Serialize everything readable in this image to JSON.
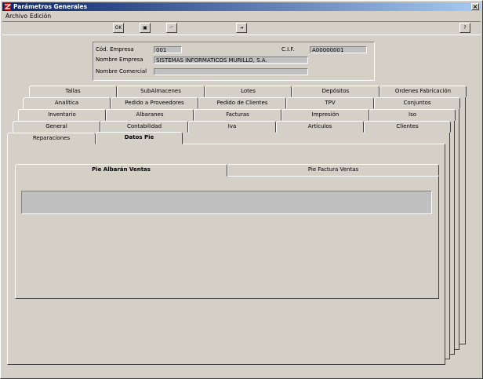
{
  "window": {
    "title": "Parámetros Generales",
    "close_label": "×"
  },
  "menu": [
    {
      "label": "Archivo"
    },
    {
      "label": "Edición"
    }
  ],
  "toolbar": {
    "buttons": [
      {
        "name": "ok",
        "glyph": "OK"
      },
      {
        "name": "save",
        "glyph": "▣"
      },
      {
        "name": "undo",
        "glyph": "↶"
      },
      {
        "name": "exit",
        "glyph": "⇥"
      },
      {
        "name": "help",
        "glyph": "?"
      }
    ]
  },
  "header": {
    "cod_empresa_label": "Cód. Empresa",
    "cod_empresa_value": "001",
    "cif_label": "C.I.F.",
    "cif_value": "A00000001",
    "nombre_empresa_label": "Nombre Empresa",
    "nombre_empresa_value": "SISTEMAS INFORMATICOS MURILLO, S.A.",
    "nombre_comercial_label": "Nombre Comercial",
    "nombre_comercial_value": ""
  },
  "tabs": {
    "row1": [
      "Tallas",
      "SubAlmacenes",
      "Lotes",
      "Depósitos",
      "Ordenes Fabricación"
    ],
    "row2": [
      "Analítica",
      "Pedido a Proveedores",
      "Pedido de Clientes",
      "TPV",
      "Conjuntos"
    ],
    "row3": [
      "Inventario",
      "Albaranes",
      "Facturas",
      "Impresión",
      "Iso"
    ],
    "row4": [
      "General",
      "Contabilidad",
      "Iva",
      "Artículos",
      "Clientes"
    ],
    "row5": [
      "Reparaciones",
      "Datos Pie"
    ],
    "active": "Datos Pie"
  },
  "subtabs": {
    "items": [
      "Pie Albarán Ventas",
      "Pie Factura Ventas"
    ],
    "active": "Pie Albarán Ventas"
  },
  "pie_albaran_text": ""
}
